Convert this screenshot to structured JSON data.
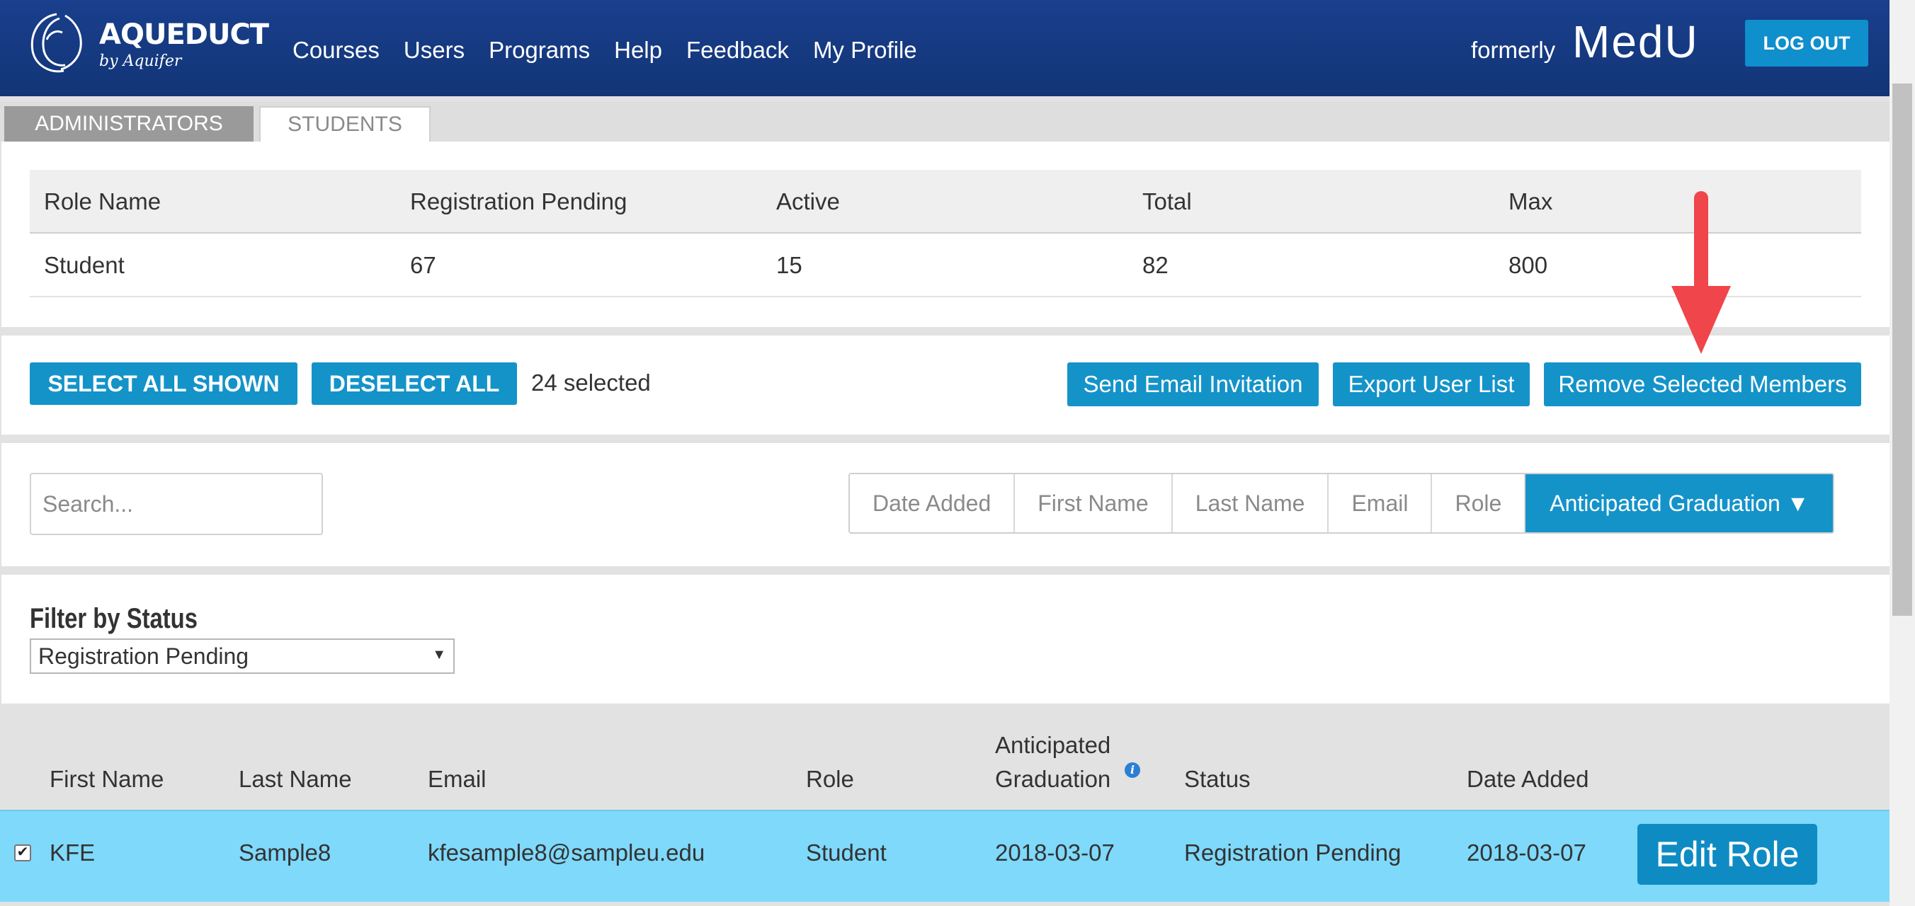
{
  "header": {
    "logo_title": "AQUEDUCT",
    "logo_subtitle": "by Aquifer",
    "nav": [
      "Courses",
      "Users",
      "Programs",
      "Help",
      "Feedback",
      "My Profile"
    ],
    "formerly": "formerly",
    "brand": "MedU",
    "logout": "LOG OUT"
  },
  "tabs": [
    "ADMINISTRATORS",
    "STUDENTS"
  ],
  "role_table": {
    "headers": [
      "Role Name",
      "Registration Pending",
      "Active",
      "Total",
      "Max"
    ],
    "row": [
      "Student",
      "67",
      "15",
      "82",
      "800"
    ]
  },
  "actions": {
    "select_all": "SELECT ALL SHOWN",
    "deselect_all": "DESELECT ALL",
    "selected_count": "24 selected",
    "send_invitation": "Send Email Invitation",
    "export_list": "Export User List",
    "remove_selected": "Remove Selected Members"
  },
  "search": {
    "placeholder": "Search..."
  },
  "sort": {
    "options": [
      "Date Added",
      "First Name",
      "Last Name",
      "Email",
      "Role"
    ],
    "active": "Anticipated Graduation ▼"
  },
  "filter": {
    "title": "Filter by Status",
    "selected": "Registration Pending"
  },
  "users_table": {
    "headers": [
      "First Name",
      "Last Name",
      "Email",
      "Role",
      "Anticipated",
      "Graduation",
      "Status",
      "Date Added"
    ],
    "rows": [
      {
        "first_name": "KFE",
        "last_name": "Sample8",
        "email": "kfesample8@sampleu.edu",
        "role": "Student",
        "anticipated_graduation": "2018-03-07",
        "status": "Registration Pending",
        "date_added": "2018-03-07",
        "checked": true,
        "edit_label": "Edit Role"
      }
    ]
  },
  "colors": {
    "header_bg": "#153a80",
    "accent": "#1493c9",
    "selected_row": "#7fd9fb",
    "annotation_arrow": "#f0454a"
  },
  "icons": [
    "aqueduct-logo-icon",
    "info-icon",
    "checkmark-icon",
    "dropdown-arrow-icon",
    "annotation-arrow-icon"
  ]
}
